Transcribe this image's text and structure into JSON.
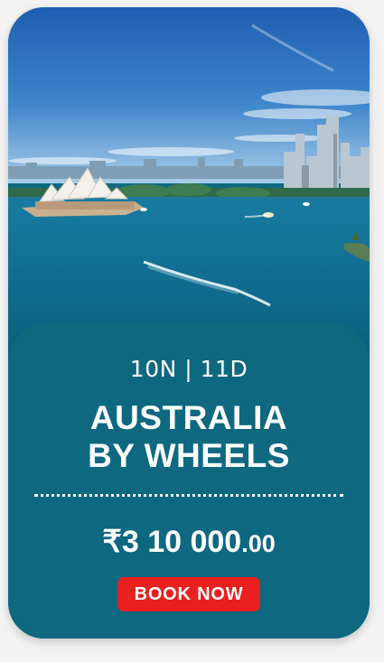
{
  "package": {
    "duration": "10N | 11D",
    "title_line1": "AUSTRALIA",
    "title_line2": "BY WHEELS",
    "price_main": "₹3 10 000",
    "price_cents": ".00",
    "book_label": "BOOK NOW"
  },
  "colors": {
    "card_bg": "#0e6880",
    "button_bg": "#ea1f1f",
    "text": "#ffffff"
  },
  "image": {
    "subject": "sydney-harbour-photo"
  }
}
